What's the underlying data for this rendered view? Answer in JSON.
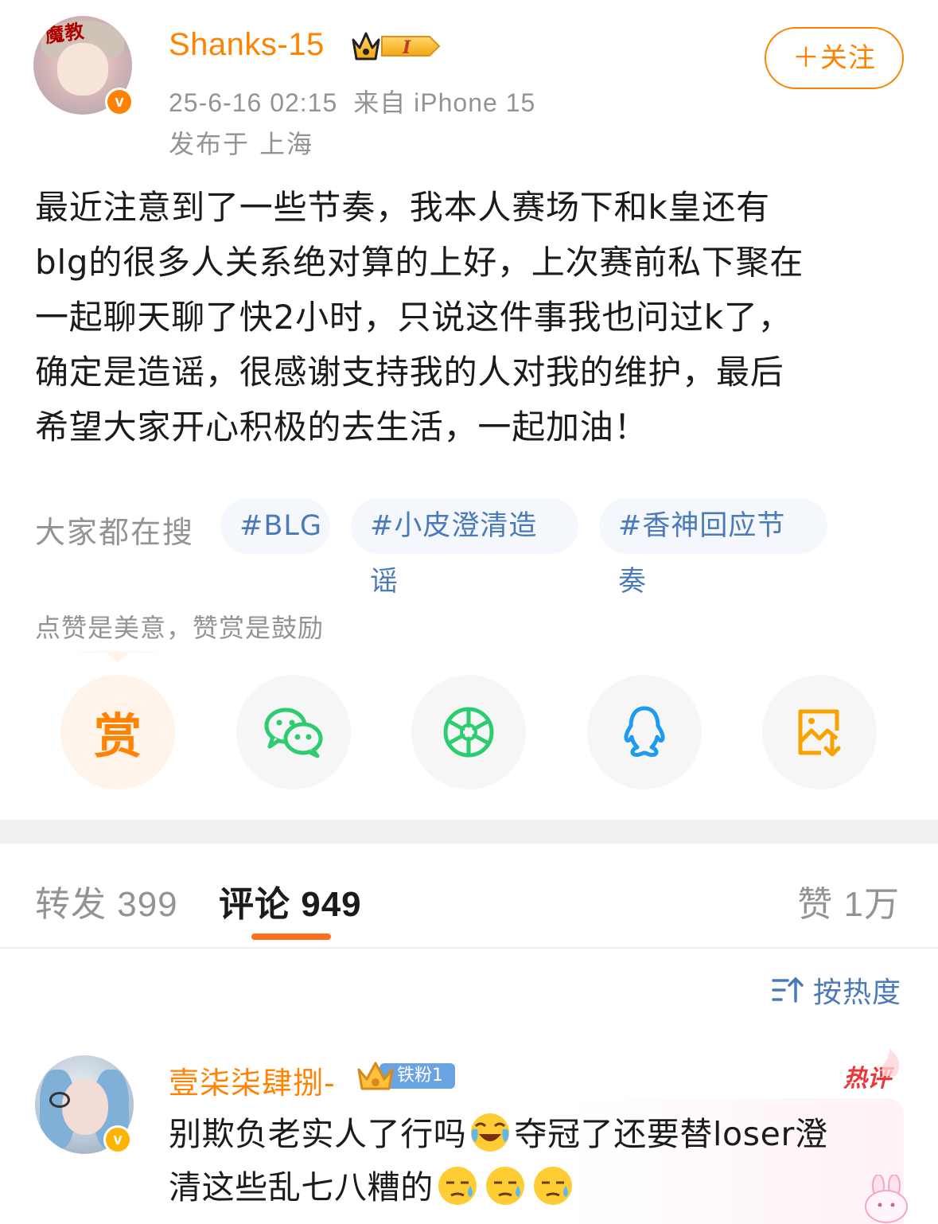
{
  "post": {
    "username": "Shanks-15",
    "level_badge": "I",
    "time": "25-6-16 02:15",
    "source": "来自 iPhone 15",
    "location": "发布于 上海",
    "follow_label": "＋关注",
    "avatar_logo_text": "魔教",
    "text_lines": [
      "最近注意到了一些节奏，我本人赛场下和k皇还有",
      " blg的很多人关系绝对算的上好，上次赛前私下聚在",
      "一起聊天聊了快2小时，只说这件事我也问过k了，",
      "确定是造谣，很感谢支持我的人对我的维护，最后",
      "希望大家开心积极的去生活，一起加油！"
    ]
  },
  "search": {
    "label": "大家都在搜",
    "tags": [
      "#BLG",
      "#小皮澄清造谣",
      "#香神回应节奏"
    ]
  },
  "reward": {
    "hint": "点赞是美意，赞赏是鼓励",
    "reward_char": "赏"
  },
  "share_icons": [
    "reward-icon",
    "wechat-icon",
    "moments-icon",
    "qq-icon",
    "save-image-icon"
  ],
  "tabs": {
    "repost": "转发 399",
    "comment": "评论 949",
    "like": "赞 1万"
  },
  "sort": {
    "label": "按热度"
  },
  "comment": {
    "username": "壹柒柒肆捌-",
    "fan_badge": "铁粉1",
    "hot_label": "热评",
    "text_part1": "别欺负老实人了行吗",
    "text_part2": "夺冠了还要替loser澄",
    "text_part3": "清这些乱七八糟的"
  },
  "colors": {
    "accent": "#ff8200",
    "link": "#4a7ab8",
    "muted": "#939393",
    "wechat_green": "#2ecc71",
    "qq_blue": "#1e9bf0",
    "hot_red": "#e8383d"
  }
}
